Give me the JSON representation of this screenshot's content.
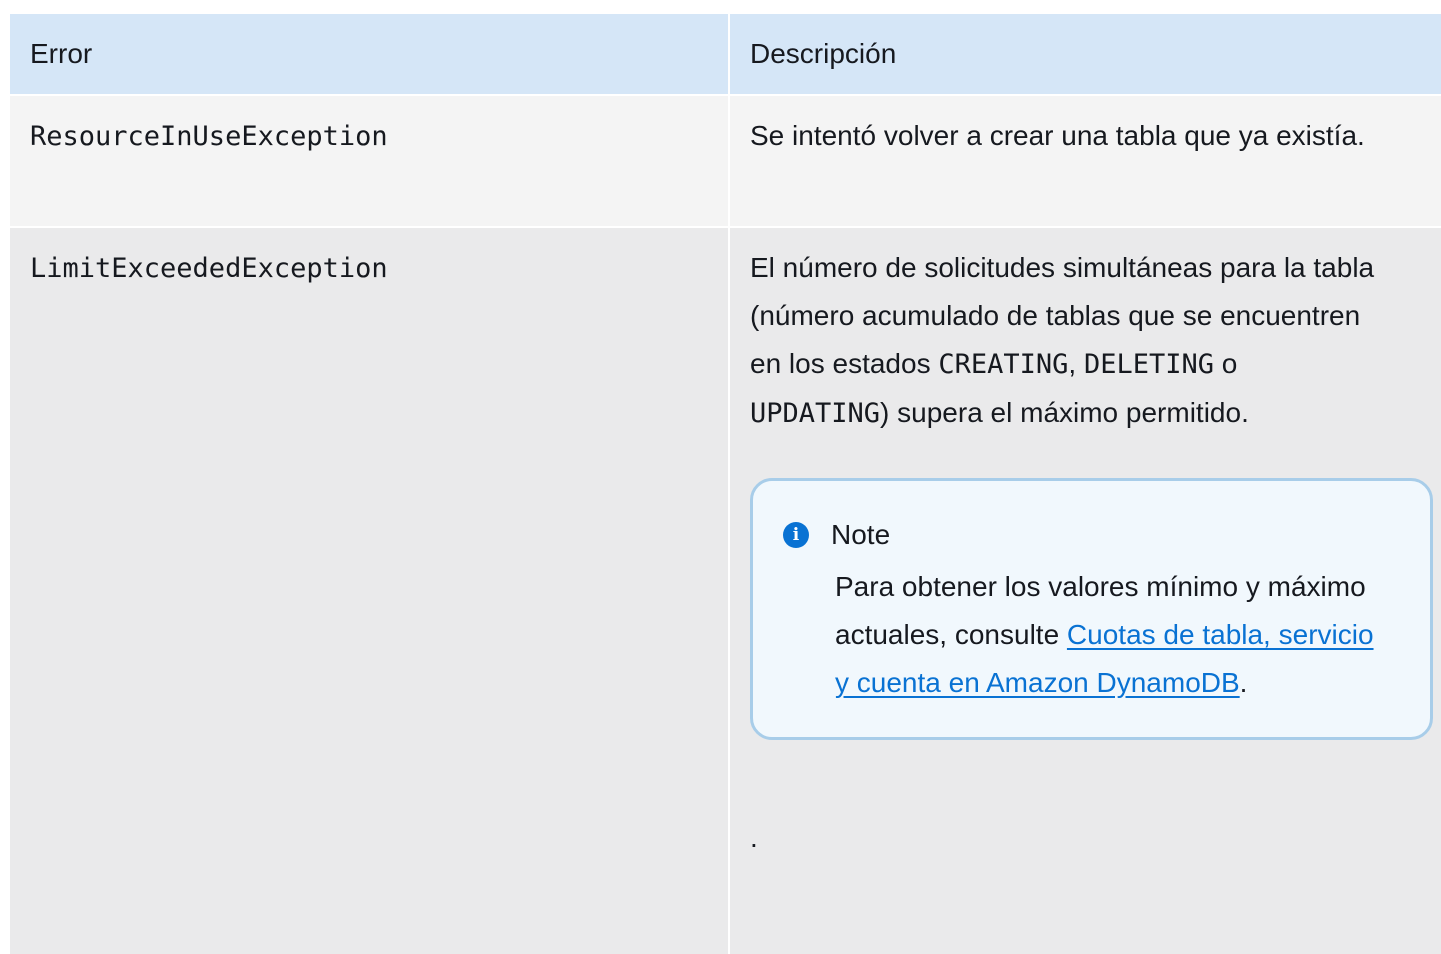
{
  "table": {
    "headers": {
      "error": "Error",
      "description": "Descripción"
    },
    "rows": [
      {
        "error": "ResourceInUseException",
        "description": "Se intentó volver a crear una tabla que ya existía."
      },
      {
        "error": "LimitExceededException",
        "description_parts": {
          "text_1": "El número de solicitudes simultáneas para la tabla (número acumulado de tablas que se encuentren en los estados ",
          "code_1": "CREATING",
          "text_2": ", ",
          "code_2": "DELETING",
          "text_3": " o ",
          "code_3": "UPDATING",
          "text_4": ") supera el máximo permitido."
        },
        "note": {
          "title": "Note",
          "body_text": "Para obtener los valores mínimo y máximo actuales, consulte ",
          "link_text": "Cuotas de tabla, servicio y cuenta en Amazon DynamoDB",
          "body_end": "."
        },
        "trailing": "."
      }
    ]
  },
  "colors": {
    "header_bg": "#d5e6f7",
    "row1_bg": "#f4f4f4",
    "row2_bg": "#eaeaeb",
    "note_bg": "#f1f8fd",
    "note_border": "#a8cde9",
    "link": "#0972d3"
  },
  "icons": {
    "note": "info-icon"
  }
}
